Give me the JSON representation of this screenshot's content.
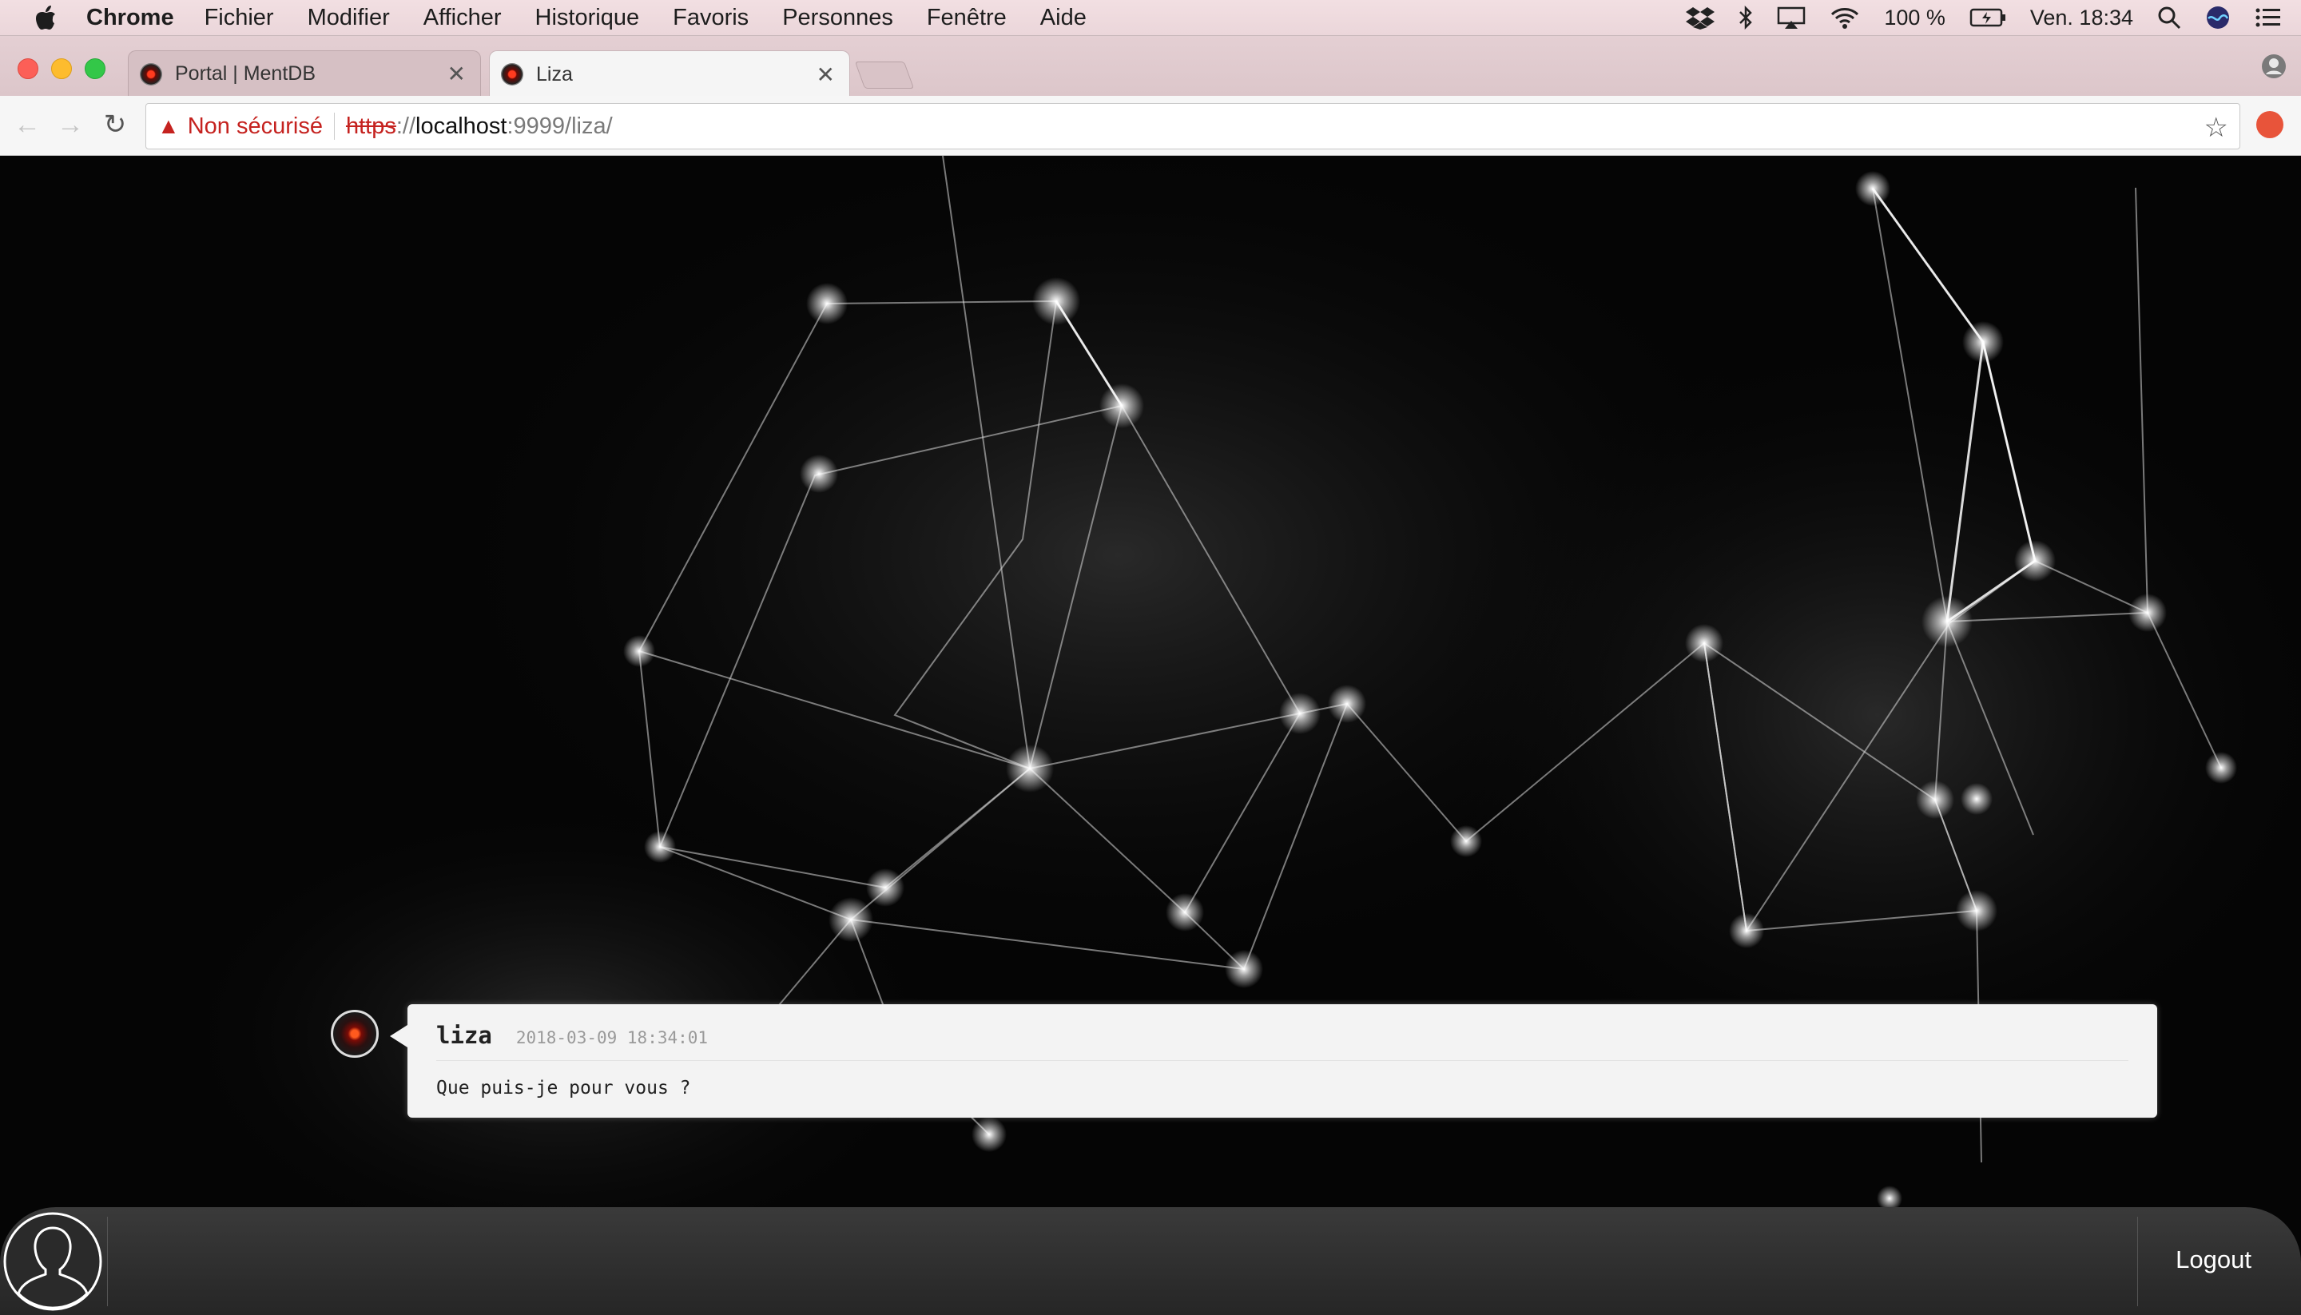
{
  "menubar": {
    "app_name": "Chrome",
    "items": [
      "Fichier",
      "Modifier",
      "Afficher",
      "Historique",
      "Favoris",
      "Personnes",
      "Fenêtre",
      "Aide"
    ],
    "battery": "100 %",
    "clock": "Ven. 18:34"
  },
  "tabs": [
    {
      "title": "Portal | MentDB",
      "active": false
    },
    {
      "title": "Liza",
      "active": true
    }
  ],
  "toolbar": {
    "security_label": "Non sécurisé",
    "url_scheme": "https",
    "url_sep": "://",
    "url_host": "localhost",
    "url_rest": ":9999/liza/"
  },
  "chat": {
    "messages": [
      {
        "sender": "liza",
        "timestamp": "2018-03-09 18:34:01",
        "text": "Que puis-je pour vous ?"
      }
    ]
  },
  "footer": {
    "logout_label": "Logout"
  },
  "colors": {
    "warning_red": "#c5221f",
    "bubble_bg": "#f3f3f3",
    "input_bar": "#2e2e2e"
  }
}
